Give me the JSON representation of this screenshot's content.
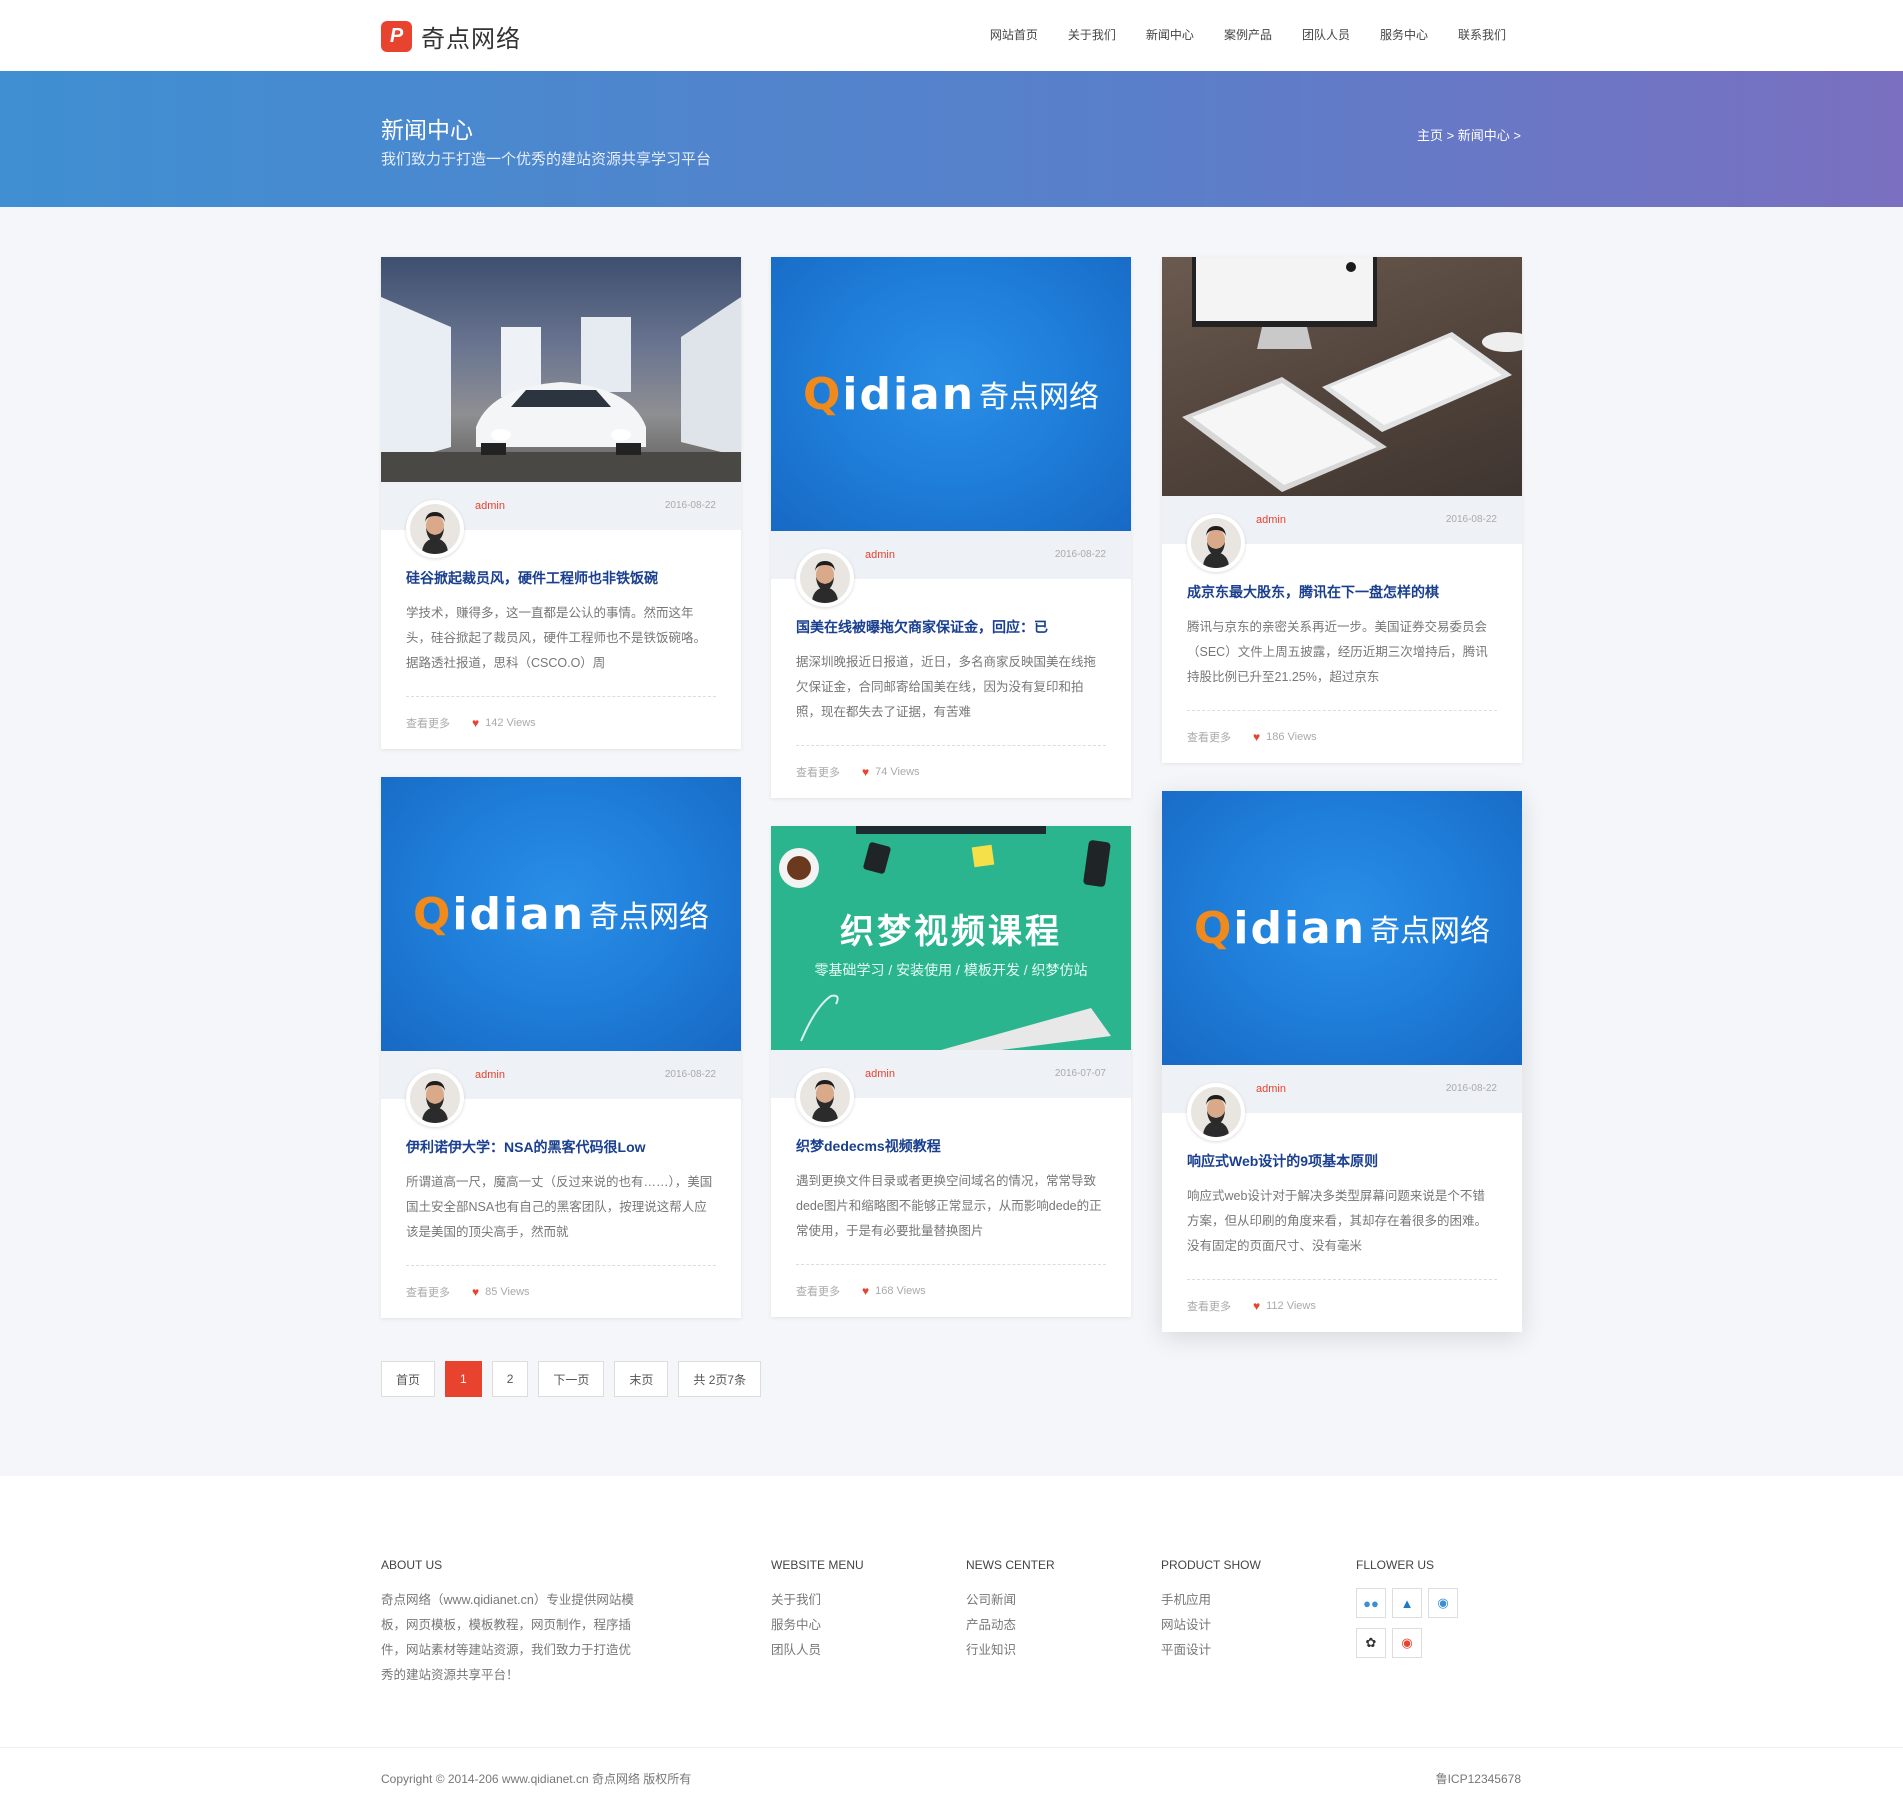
{
  "header": {
    "logo_text": "奇点网络",
    "logo_mark": "P",
    "nav": [
      "网站首页",
      "关于我们",
      "新闻中心",
      "案例产品",
      "团队人员",
      "服务中心",
      "联系我们"
    ]
  },
  "banner": {
    "title": "新闻中心",
    "subtitle": "我们致力于打造一个优秀的建站资源共享学习平台",
    "breadcrumb": "主页 > 新闻中心 >"
  },
  "cards": [
    {
      "thumb": "car-photo",
      "author": "admin",
      "date": "2016-08-22",
      "title": "硅谷掀起裁员风，硬件工程师也非铁饭碗",
      "excerpt": "学技术，赚得多，这一直都是公认的事情。然而这年头，硅谷掀起了裁员风，硬件工程师也不是铁饭碗咯。据路透社报道，思科（CSCO.O）周",
      "more": "查看更多",
      "views": "142 Views"
    },
    {
      "thumb": "qidian",
      "author": "admin",
      "date": "2016-08-22",
      "title": "国美在线被曝拖欠商家保证金，回应：已",
      "excerpt": "据深圳晚报近日报道，近日，多名商家反映国美在线拖欠保证金，合同邮寄给国美在线，因为没有复印和拍照，现在都失去了证据，有苦难",
      "more": "查看更多",
      "views": "74 Views"
    },
    {
      "thumb": "desk-photo",
      "author": "admin",
      "date": "2016-08-22",
      "title": "成京东最大股东，腾讯在下一盘怎样的棋",
      "excerpt": "腾讯与京东的亲密关系再近一步。美国证券交易委员会（SEC）文件上周五披露，经历近期三次增持后，腾讯持股比例已升至21.25%，超过京东",
      "more": "查看更多",
      "views": "186 Views"
    },
    {
      "thumb": "qidian",
      "author": "admin",
      "date": "2016-08-22",
      "title": "伊利诺伊大学：NSA的黑客代码很Low",
      "excerpt": "所谓道高一尺，魔高一丈（反过来说的也有……），美国国土安全部NSA也有自己的黑客团队，按理说这帮人应该是美国的顶尖高手，然而就",
      "more": "查看更多",
      "views": "85 Views"
    },
    {
      "thumb": "course",
      "author": "admin",
      "date": "2016-07-07",
      "title": "织梦dedecms视频教程",
      "excerpt": "遇到更换文件目录或者更换空间域名的情况，常常导致dede图片和缩略图不能够正常显示，从而影响dede的正常使用，于是有必要批量替换图片",
      "more": "查看更多",
      "views": "168 Views"
    },
    {
      "thumb": "qidian",
      "author": "admin",
      "date": "2016-08-22",
      "title": "响应式Web设计的9项基本原则",
      "excerpt": "响应式web设计对于解决多类型屏幕问题来说是个不错方案，但从印刷的角度来看，其却存在着很多的困难。没有固定的页面尺寸、没有毫米",
      "more": "查看更多",
      "views": "112 Views"
    }
  ],
  "qidian_logo": {
    "q": "Q",
    "latin": "idian",
    "cn": "奇点网络"
  },
  "course_thumb": {
    "title": "织梦视频课程",
    "subtitle": "零基础学习 / 安装使用 / 模板开发 / 织梦仿站"
  },
  "pager": {
    "first": "首页",
    "p1": "1",
    "p2": "2",
    "next": "下一页",
    "last": "末页",
    "total": "共 2页7条"
  },
  "footer": {
    "about": {
      "head": "ABOUT US",
      "text": [
        "奇点网络（www.qidianet.cn）专业提供网站模",
        "板，网页模板，模板教程，网页制作，程序插",
        "件，网站素材等建站资源，我们致力于打造优",
        "秀的建站资源共享平台！"
      ]
    },
    "menu": {
      "head": "WEBSITE MENU",
      "items": [
        "关于我们",
        "服务中心",
        "团队人员"
      ]
    },
    "news": {
      "head": "NEWS CENTER",
      "items": [
        "公司新闻",
        "产品动态",
        "行业知识"
      ]
    },
    "product": {
      "head": "PRODUCT SHOW",
      "items": [
        "手机应用",
        "网站设计",
        "平面设计"
      ]
    },
    "follow": {
      "head": "FLLOWER US",
      "icons": [
        "wechat-icon",
        "qq-icon",
        "weibo-icon",
        "renren-icon",
        "pinterest-icon"
      ]
    },
    "copyright": "Copyright © 2014-206 www.qidianet.cn 奇点网络 版权所有",
    "icp": "鲁ICP12345678"
  },
  "colors": {
    "accent": "#e8432f",
    "title_blue": "#1a3f8f",
    "banner_start": "#3f8fd2",
    "banner_end": "#7a6fc0"
  }
}
